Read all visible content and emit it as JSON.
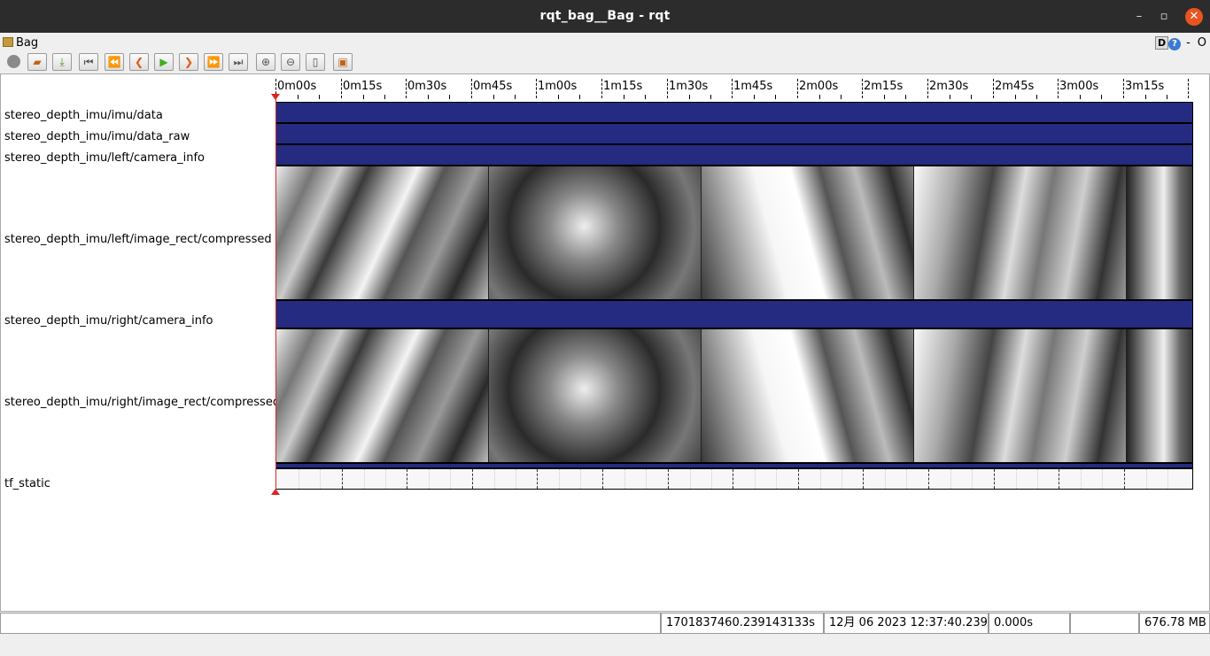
{
  "window": {
    "title": "rqt_bag__Bag - rqt",
    "minimize_glyph": "–",
    "maximize_glyph": "▫",
    "close_glyph": "✕"
  },
  "plugin": {
    "label": "Bag",
    "d_label": "D",
    "help_label": "?",
    "dash_label": "-",
    "o_label": "O"
  },
  "toolbar": {
    "buttons": [
      "record-icon",
      "open-icon",
      "save-icon",
      "begin-icon",
      "fast-rewind-icon",
      "step-back-icon",
      "play-icon",
      "step-forward-icon",
      "fast-forward-icon",
      "end-icon",
      "zoom-in-icon",
      "zoom-out-icon",
      "zoom-reset-icon",
      "thumbnails-icon"
    ],
    "glyphs": {
      "begin": "⏮",
      "fast_rewind": "⏪",
      "step_back": "❮",
      "play": "▶",
      "step_forward": "❯",
      "fast_forward": "⏩",
      "end": "⏭",
      "zoom_in": "⊕",
      "zoom_out": "⊖",
      "zoom_reset": "▯",
      "thumbnails": "▣"
    }
  },
  "timeline": {
    "ticks": [
      "0m00s",
      "0m15s",
      "0m30s",
      "0m45s",
      "1m00s",
      "1m15s",
      "1m30s",
      "1m45s",
      "2m00s",
      "2m15s",
      "2m30s",
      "2m45s",
      "3m00s",
      "3m15s"
    ],
    "topics": [
      "stereo_depth_imu/imu/data",
      "stereo_depth_imu/imu/data_raw",
      "stereo_depth_imu/left/camera_info",
      "stereo_depth_imu/left/image_rect/compressed",
      "stereo_depth_imu/right/camera_info",
      "stereo_depth_imu/right/image_rect/compressed",
      "tf_static"
    ],
    "band_color": "#252b80",
    "cursor_color": "#d22222"
  },
  "status": {
    "message": "",
    "timestamp": "1701837460.239143133s",
    "date": "12月 06 2023 12:37:40.239",
    "elapsed": "0.000s",
    "rate": "",
    "size": "676.78 MB"
  }
}
